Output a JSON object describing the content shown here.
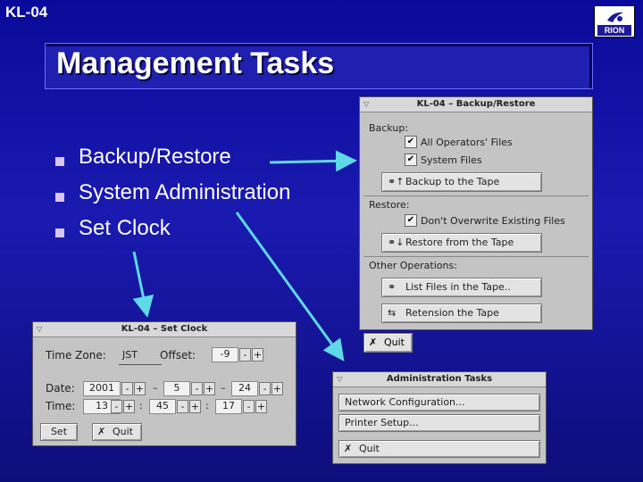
{
  "slide": {
    "code": "KL-04",
    "title": "Management Tasks",
    "logo_text": "RION",
    "bullets": [
      "Backup/Restore",
      "System Administration",
      "Set Clock"
    ]
  },
  "backup_window": {
    "title": "KL-04 – Backup/Restore",
    "backup_label": "Backup:",
    "all_operators": "All Operators' Files",
    "system_files": "System Files",
    "backup_button": "Backup to the Tape",
    "restore_label": "Restore:",
    "dont_overwrite": "Don't Overwrite Existing Files",
    "restore_button": "Restore from the Tape",
    "other_label": "Other Operations:",
    "list_button": "List Files in the Tape..",
    "retension_button": "Retension the Tape",
    "quit": "Quit",
    "check_mark": "✔"
  },
  "clock_window": {
    "title": "KL-04 – Set Clock",
    "timezone_label": "Time Zone:",
    "timezone_value": "JST",
    "offset_label": "Offset:",
    "offset_value": "-9",
    "date_label": "Date:",
    "year": "2001",
    "month": "5",
    "day": "24",
    "time_label": "Time:",
    "hour": "13",
    "minute": "45",
    "second": "17",
    "set": "Set",
    "quit": "Quit",
    "minus": "-",
    "plus": "+",
    "dash": "–",
    "colon": ":"
  },
  "admin_window": {
    "title": "Administration Tasks",
    "network": "Network Configuration...",
    "printer": "Printer Setup...",
    "quit": "Quit"
  },
  "colors": {
    "background": "#1a1ab0",
    "arrow": "#5fd8e8",
    "window": "#c4c4c4"
  }
}
